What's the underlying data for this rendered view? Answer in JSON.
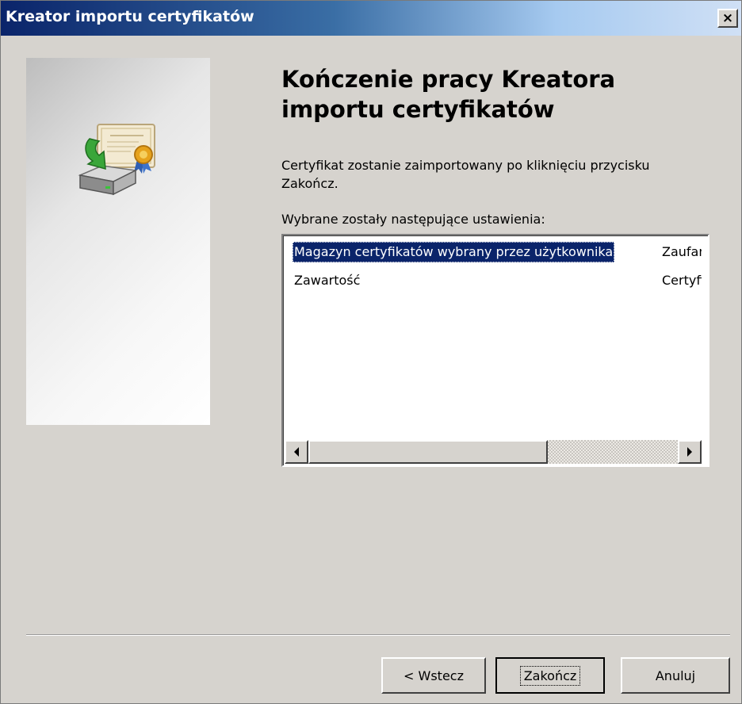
{
  "window": {
    "title": "Kreator importu certyfikatów",
    "close_glyph": "×"
  },
  "page": {
    "heading_line1": "Kończenie pracy Kreatora",
    "heading_line2": "importu certyfikatów",
    "description_line1": "Certyfikat zostanie zaimportowany po kliknięciu przycisku",
    "description_line2": "Zakończ.",
    "settings_label": "Wybrane zostały następujące ustawienia:"
  },
  "settings_list": {
    "rows": [
      {
        "name": "Magazyn certyfikatów wybrany przez użytkownika",
        "value": "Zaufane główne urzędy certyfikacji",
        "selected": true
      },
      {
        "name": "Zawartość",
        "value": "Certyfikat",
        "selected": false
      }
    ],
    "scroll_left_glyph": "◀",
    "scroll_right_glyph": "▶"
  },
  "buttons": {
    "back": "< Wstecz",
    "finish": "Zakończ",
    "cancel": "Anuluj"
  },
  "icons": {
    "wizard": "certificate-import-icon",
    "close": "close-icon",
    "scroll_left": "arrow-left-icon",
    "scroll_right": "arrow-right-icon"
  },
  "colors": {
    "selection": "#0a246a",
    "dialog_face": "#d6d3ce"
  }
}
